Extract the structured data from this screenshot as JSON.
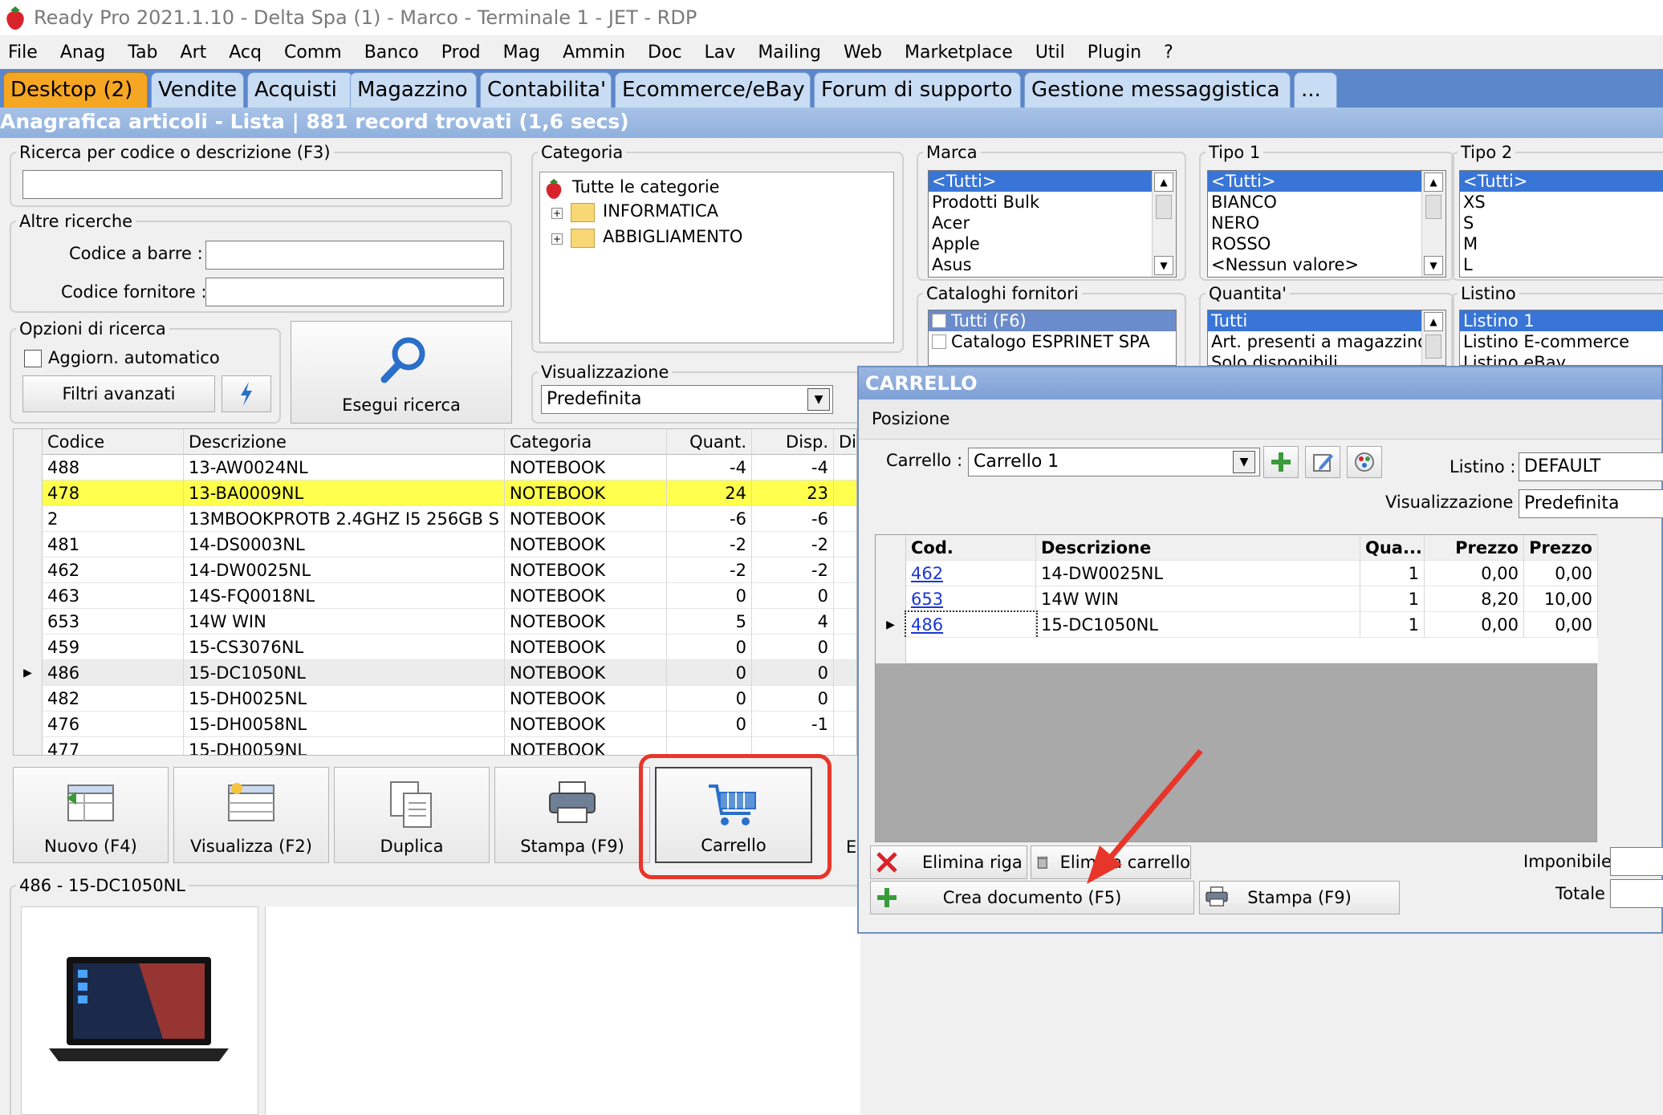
{
  "window": {
    "title": "Ready Pro 2021.1.10 - Delta Spa (1) - Marco - Terminale 1 - JET - RDP"
  },
  "menu": [
    "File",
    "Anag",
    "Tab",
    "Art",
    "Acq",
    "Comm",
    "Banco",
    "Prod",
    "Mag",
    "Ammin",
    "Doc",
    "Lav",
    "Mailing",
    "Web",
    "Marketplace",
    "Util",
    "Plugin",
    "?"
  ],
  "tabs": [
    "Desktop (2)",
    "Vendite",
    "Acquisti",
    "Magazzino",
    "Contabilita'",
    "Ecommerce/eBay",
    "Forum di supporto",
    "Gestione messaggistica",
    "..."
  ],
  "subtitle": "Anagrafica articoli  - Lista | 881 record trovati (1,6 secs)",
  "search": {
    "legend": "Ricerca per codice o descrizione (F3)",
    "other_legend": "Altre ricerche",
    "barcode_label": "Codice a barre :",
    "supplier_label": "Codice fornitore :",
    "options_legend": "Opzioni di ricerca",
    "auto_update": "Aggiorn. automatico",
    "advanced_filters": "Filtri avanzati",
    "run_search": "Esegui ricerca"
  },
  "category": {
    "legend": "Categoria",
    "root": "Tutte le categorie",
    "items": [
      "INFORMATICA",
      "ABBIGLIAMENTO"
    ]
  },
  "view": {
    "legend": "Visualizzazione",
    "value": "Predefinita"
  },
  "brand": {
    "legend": "Marca",
    "items": [
      "<Tutti>",
      "Prodotti Bulk",
      "Acer",
      "Apple",
      "Asus"
    ]
  },
  "type1": {
    "legend": "Tipo 1",
    "items": [
      "<Tutti>",
      "BIANCO",
      "NERO",
      "ROSSO",
      "<Nessun valore>"
    ]
  },
  "type2": {
    "legend": "Tipo 2",
    "items": [
      "<Tutti>",
      "XS",
      "S",
      "M",
      "L"
    ]
  },
  "catalogs": {
    "legend": "Cataloghi fornitori",
    "items": [
      "Tutti (F6)",
      "Catalogo ESPRINET SPA"
    ]
  },
  "quantity": {
    "legend": "Quantita'",
    "items": [
      "Tutti",
      "Art. presenti a magazzino",
      "Solo disponibili"
    ]
  },
  "pricelist": {
    "legend": "Listino",
    "items": [
      "Listino 1",
      "Listino E-commerce",
      "Listino eBay"
    ]
  },
  "grid": {
    "headers": [
      "Codice",
      "Descrizione",
      "Categoria",
      "Quant.",
      "Disp.",
      "Dis"
    ],
    "rows": [
      [
        "488",
        "13-AW0024NL",
        "NOTEBOOK",
        "-4",
        "-4"
      ],
      [
        "478",
        "13-BA0009NL",
        "NOTEBOOK",
        "24",
        "23"
      ],
      [
        "2",
        "13MBOOKPROTB 2.4GHZ I5 256GB S",
        "NOTEBOOK",
        "-6",
        "-6"
      ],
      [
        "481",
        "14-DS0003NL",
        "NOTEBOOK",
        "-2",
        "-2"
      ],
      [
        "462",
        "14-DW0025NL",
        "NOTEBOOK",
        "-2",
        "-2"
      ],
      [
        "463",
        "14S-FQ0018NL",
        "NOTEBOOK",
        "0",
        "0"
      ],
      [
        "653",
        "14W WIN",
        "NOTEBOOK",
        "5",
        "4"
      ],
      [
        "459",
        "15-CS3076NL",
        "NOTEBOOK",
        "0",
        "0"
      ],
      [
        "486",
        "15-DC1050NL",
        "NOTEBOOK",
        "0",
        "0"
      ],
      [
        "482",
        "15-DH0025NL",
        "NOTEBOOK",
        "0",
        "0"
      ],
      [
        "476",
        "15-DH0058NL",
        "NOTEBOOK",
        "0",
        "-1"
      ],
      [
        "477",
        "15-DH0059NL",
        "NOTEBOOK",
        "",
        ""
      ]
    ]
  },
  "actions": {
    "new": "Nuovo (F4)",
    "view": "Visualizza (F2)",
    "duplicate": "Duplica",
    "print": "Stampa (F9)",
    "cart": "Carrello",
    "extra": "El"
  },
  "detail": {
    "legend": "486 - 15-DC1050NL"
  },
  "cart": {
    "title": "CARRELLO",
    "section": "Posizione",
    "cart_label": "Carrello :",
    "cart_value": "Carrello 1",
    "list_label": "Listino :",
    "list_value": "DEFAULT",
    "view_label": "Visualizzazione :",
    "view_value": "Predefinita",
    "headers": [
      "Cod.",
      "Descrizione",
      "Qua...",
      "Prezzo",
      "Prezzo"
    ],
    "rows": [
      [
        "462",
        "14-DW0025NL",
        "1",
        "0,00",
        "0,00"
      ],
      [
        "653",
        "14W WIN",
        "1",
        "8,20",
        "10,00"
      ],
      [
        "486",
        "15-DC1050NL",
        "1",
        "0,00",
        "0,00"
      ]
    ],
    "delete_row": "Elimina riga",
    "delete_cart": "Elimina carrello",
    "create_doc": "Crea documento (F5)",
    "print": "Stampa (F9)",
    "taxable_label": "Imponibile",
    "total_label": "Totale"
  },
  "colors": {
    "accent": "#f5a623",
    "tabbar": "#5b86c9",
    "highlight_row": "#ffff4d",
    "annotation": "#e8352a"
  }
}
